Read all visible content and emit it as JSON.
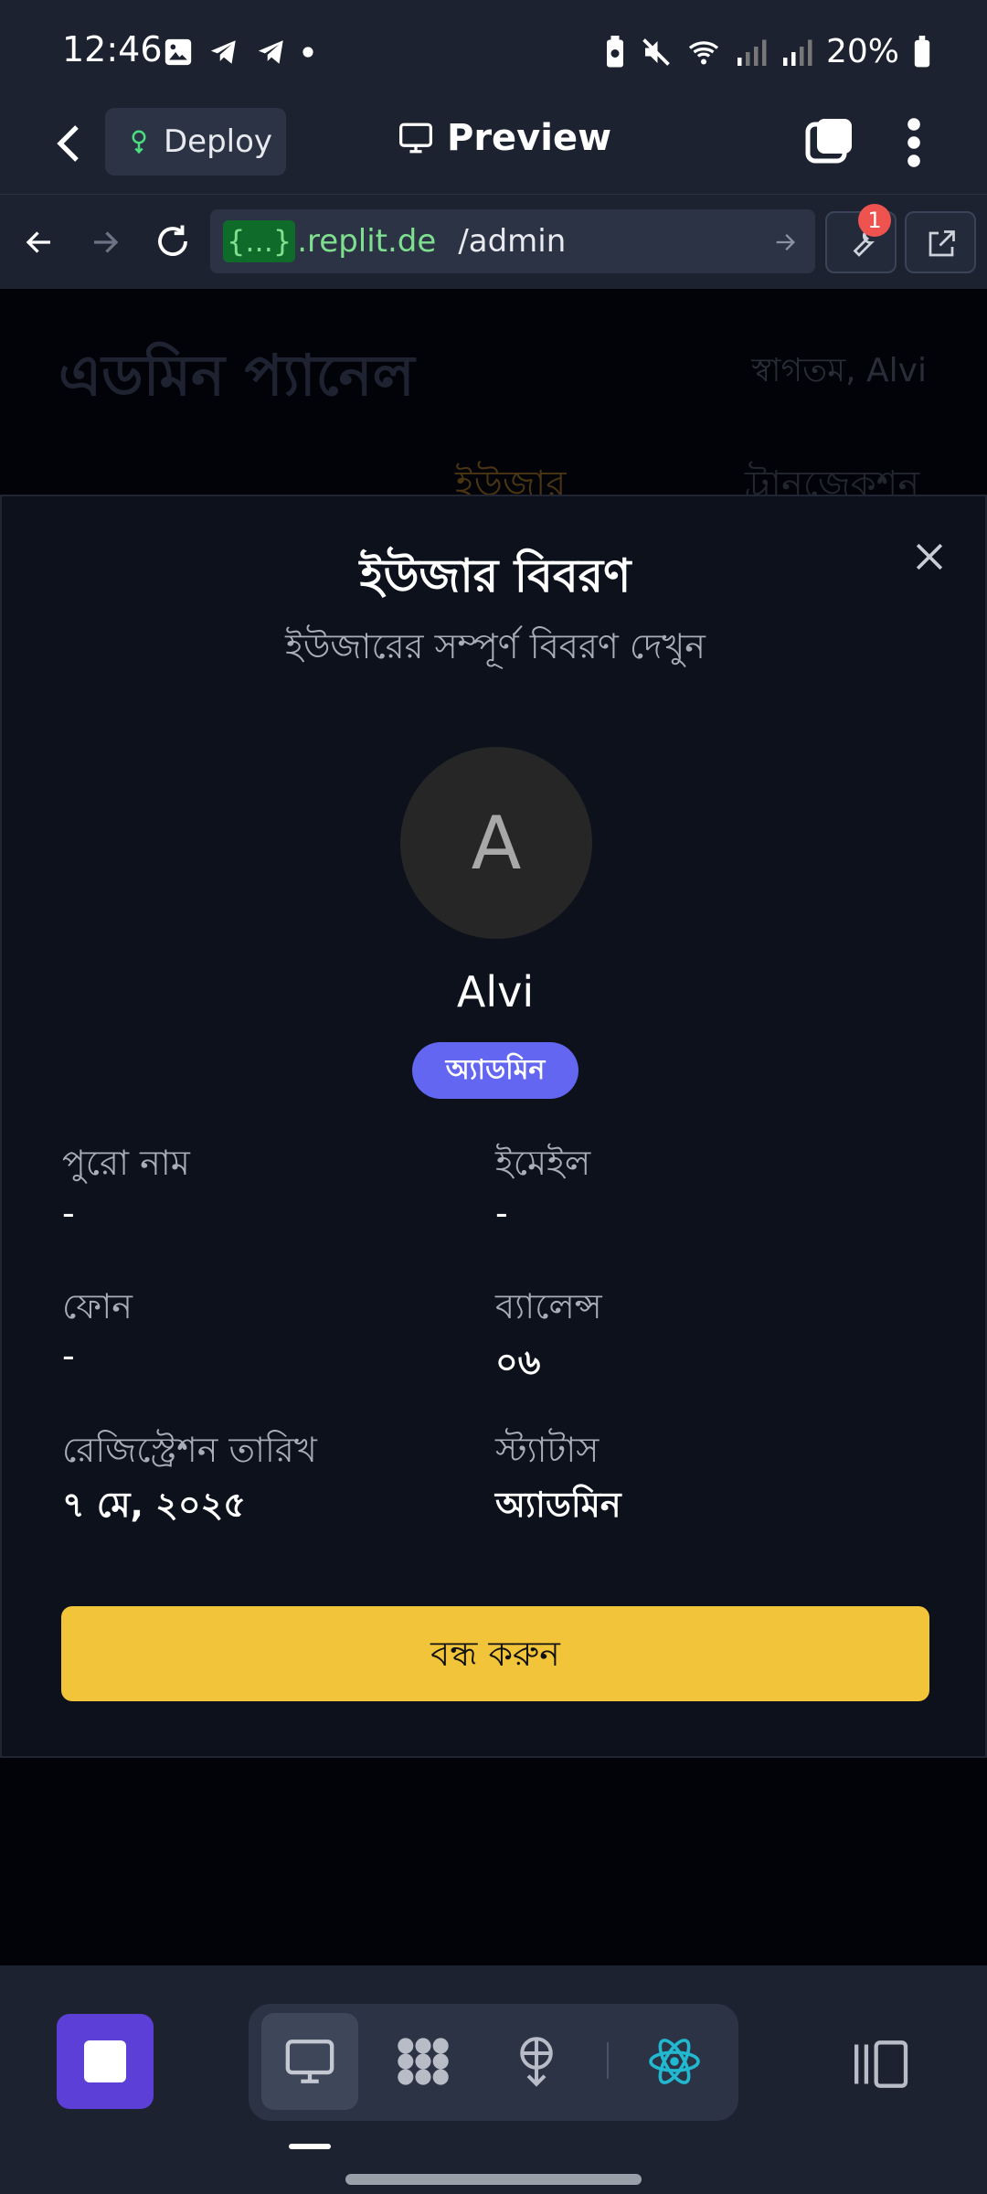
{
  "status_bar": {
    "time": "12:46",
    "battery": "20%"
  },
  "app_bar": {
    "deploy_label": "Deploy",
    "title": "Preview"
  },
  "url_bar": {
    "brace": "{...}",
    "domain": ".replit.de",
    "path": "/admin",
    "badge_count": "1"
  },
  "page": {
    "title": "এডমিন প্যানেল",
    "welcome": "স্বাগতম, Alvi",
    "tabs": [
      "ইউজার",
      "ট্রানজেকশন"
    ]
  },
  "modal": {
    "title": "ইউজার বিবরণ",
    "subtitle": "ইউজারের সম্পূর্ণ বিবরণ দেখুন",
    "avatar_initial": "A",
    "username": "Alvi",
    "role_badge": "অ্যাডমিন",
    "fields": {
      "full_name": {
        "label": "পুরো নাম",
        "value": "-"
      },
      "email": {
        "label": "ইমেইল",
        "value": "-"
      },
      "phone": {
        "label": "ফোন",
        "value": "-"
      },
      "balance": {
        "label": "ব্যালেন্স",
        "value": "০৬"
      },
      "reg_date": {
        "label": "রেজিস্ট্রেশন তারিখ",
        "value": "৭ মে, ২০২৫"
      },
      "status": {
        "label": "স্ট্যাটাস",
        "value": "অ্যাডমিন"
      }
    },
    "close_button": "বন্ধ করুন"
  },
  "colors": {
    "accent": "#f2c43a",
    "badge": "#6366f1",
    "stop": "#5b3fd6",
    "url_green": "#7ee08f"
  }
}
